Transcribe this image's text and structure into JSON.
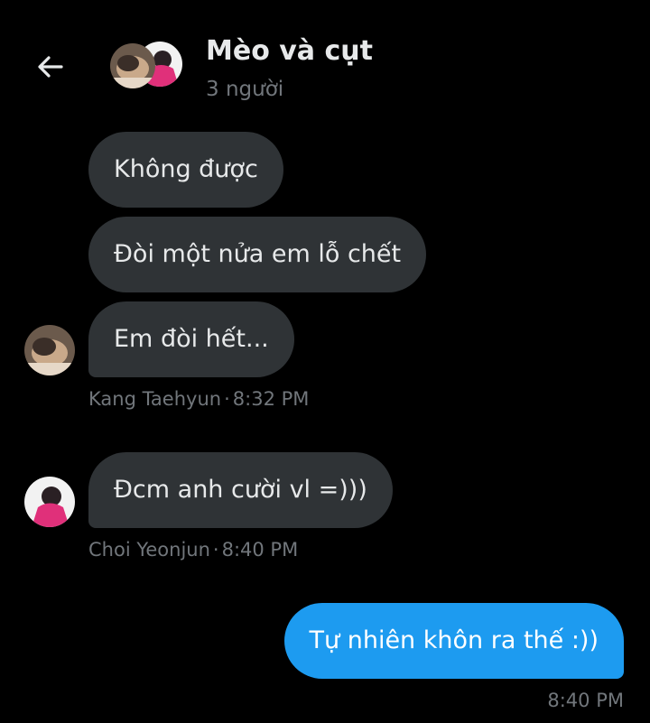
{
  "header": {
    "back_icon": "arrow-left-icon",
    "title": "Mèo và cụt",
    "subtitle": "3 người"
  },
  "messages": [
    {
      "text": "Không được",
      "direction": "incoming"
    },
    {
      "text": "Đòi một nửa em lỗ chết",
      "direction": "incoming"
    },
    {
      "text": "Em đòi hết...",
      "direction": "incoming"
    },
    {
      "text": "Đcm anh cười vl =)))",
      "direction": "incoming"
    },
    {
      "text": "Tự nhiên khôn ra thế :))",
      "direction": "outgoing"
    }
  ],
  "meta": [
    {
      "sender": "Kang Taehyun",
      "separator": "·",
      "time": "8:32 PM"
    },
    {
      "sender": "Choi Yeonjun",
      "separator": "·",
      "time": "8:40 PM"
    },
    {
      "time": "8:40 PM"
    }
  ],
  "colors": {
    "background": "#000000",
    "incoming_bubble": "#2f3336",
    "outgoing_bubble": "#1d9bf0",
    "primary_text": "#e7e9ea",
    "secondary_text": "#71767b"
  }
}
